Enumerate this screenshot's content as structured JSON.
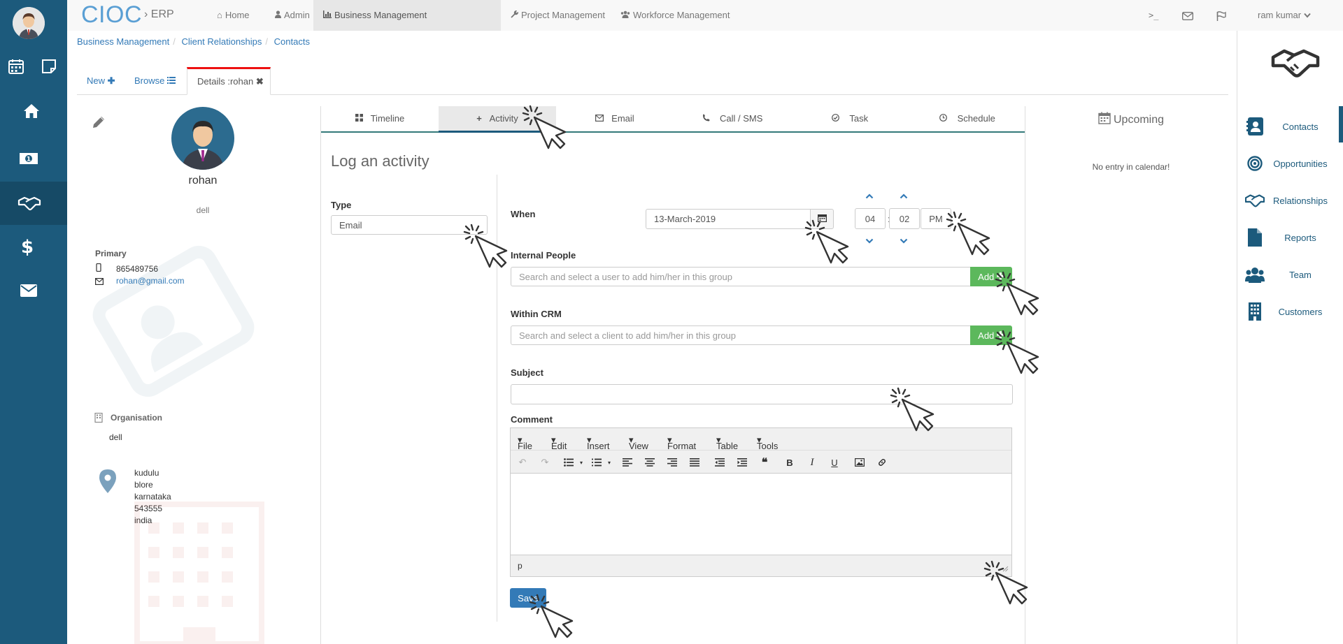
{
  "user": {
    "name": "ram kumar"
  },
  "topnav": {
    "brand": "CIOC",
    "brand_suffix": "ERP",
    "items": [
      {
        "label": "Home",
        "icon": "home-icon"
      },
      {
        "label": "Admin",
        "icon": "user-icon"
      },
      {
        "label": "Business Management",
        "icon": "bar-chart-icon",
        "active": true
      },
      {
        "label": "Project Management",
        "icon": "wrench-icon"
      },
      {
        "label": "Workforce Management",
        "icon": "users-icon"
      }
    ],
    "right_icons": [
      "terminal-icon",
      "mail-icon",
      "flag-icon"
    ]
  },
  "breadcrumb": [
    "Business Management",
    "Client Relationships",
    "Contacts"
  ],
  "tabs": [
    {
      "label": "New",
      "icon": "plus-icon"
    },
    {
      "label": "Browse",
      "icon": "list-icon"
    },
    {
      "label": "Details :rohan",
      "icon": "close-icon",
      "active": true
    }
  ],
  "contact": {
    "name": "rohan",
    "company": "dell",
    "primary_label": "Primary",
    "phone": "865489756",
    "email": "rohan@gmail.com",
    "organisation_label": "Organisation",
    "organisation": "dell",
    "address": [
      "kudulu",
      "blore",
      "karnataka",
      "543555",
      "india"
    ]
  },
  "activity_tabs": [
    {
      "label": "Timeline",
      "icon": "grid-icon"
    },
    {
      "label": "Activity",
      "icon": "plus-icon",
      "active": true
    },
    {
      "label": "Email",
      "icon": "envelope-icon"
    },
    {
      "label": "Call / SMS",
      "icon": "phone-icon"
    },
    {
      "label": "Task",
      "icon": "check-circle-icon"
    },
    {
      "label": "Schedule",
      "icon": "clock-icon"
    }
  ],
  "log": {
    "title": "Log an activity",
    "type_label": "Type",
    "type_value": "Email",
    "when_label": "When",
    "date_value": "13-March-2019",
    "hour": "04",
    "minute": "02",
    "meridian": "PM",
    "internal_label": "Internal People",
    "internal_placeholder": "Search and select a user to add him/her in this group",
    "crm_label": "Within CRM",
    "crm_placeholder": "Search and select a client to add him/her in this group",
    "add_label": "Add",
    "subject_label": "Subject",
    "subject_value": "",
    "comment_label": "Comment",
    "editor_menu": [
      "File",
      "Edit",
      "Insert",
      "View",
      "Format",
      "Table",
      "Tools"
    ],
    "editor_status": "p",
    "save_label": "Save"
  },
  "upcoming": {
    "title": "Upcoming",
    "empty_text": "No entry in calendar!"
  },
  "right_panel": [
    {
      "label": "Contacts",
      "icon": "contact-card-icon"
    },
    {
      "label": "Opportunities",
      "icon": "target-icon"
    },
    {
      "label": "Relationships",
      "icon": "handshake-icon"
    },
    {
      "label": "Reports",
      "icon": "file-icon"
    },
    {
      "label": "Team",
      "icon": "team-icon"
    },
    {
      "label": "Customers",
      "icon": "building-icon"
    }
  ],
  "colors": {
    "sidebar": "#1c5a7c",
    "brand": "#5a9fd4",
    "link": "#337ab7",
    "add": "#5cb85c",
    "active_tab_border": "#e11111"
  }
}
